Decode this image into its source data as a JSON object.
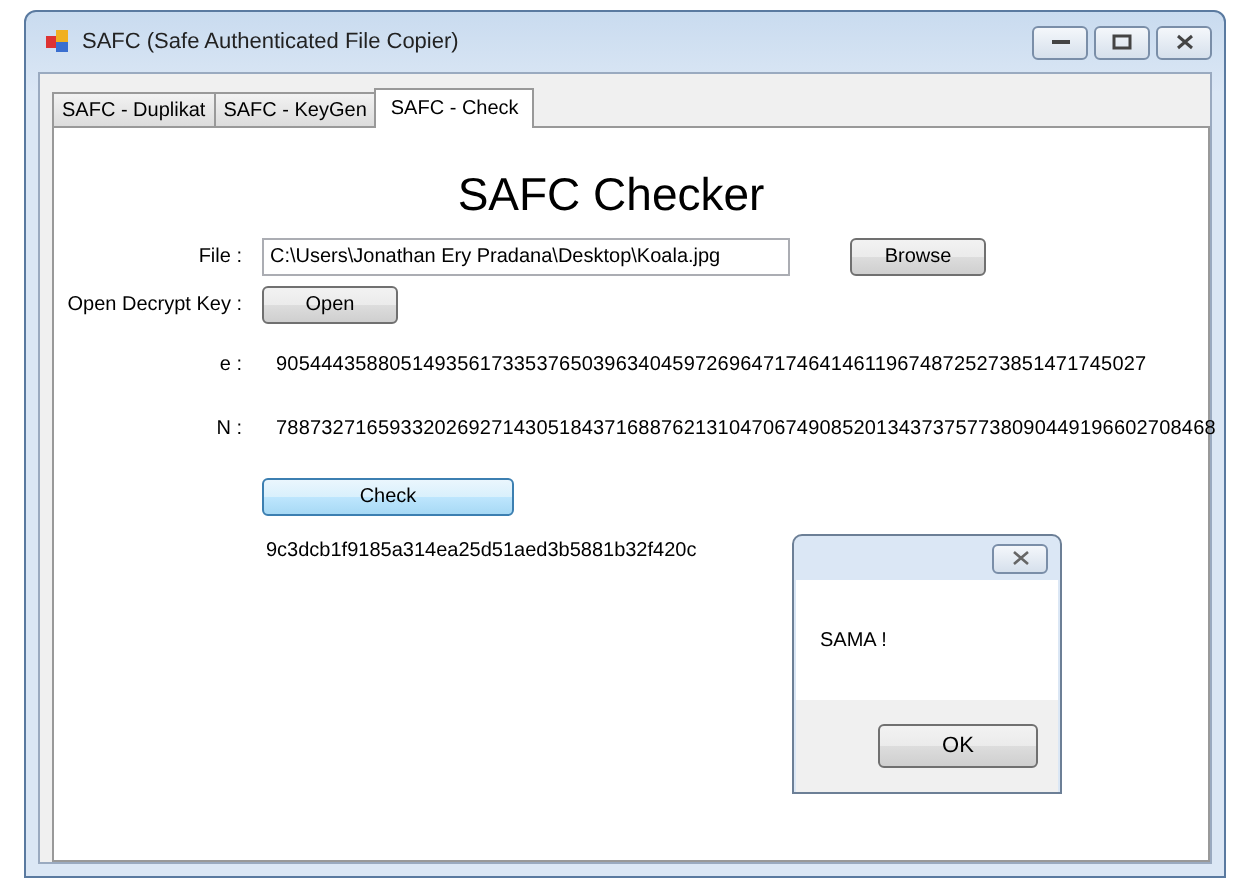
{
  "window": {
    "title": "SAFC (Safe Authenticated File Copier)"
  },
  "tabs": [
    {
      "label": "SAFC - Duplikat",
      "selected": false
    },
    {
      "label": "SAFC - KeyGen",
      "selected": false
    },
    {
      "label": "SAFC - Check",
      "selected": true
    }
  ],
  "heading": "SAFC Checker",
  "file": {
    "label": "File :",
    "value": "C:\\Users\\Jonathan Ery Pradana\\Desktop\\Koala.jpg",
    "button": "Browse"
  },
  "decrypt_key": {
    "label": "Open Decrypt Key :",
    "button": "Open"
  },
  "e": {
    "label": "e :",
    "value": "90544435880514935617335376503963404597269647174641461196748725273851471745027"
  },
  "n": {
    "label": "N :",
    "value": "78873271659332026927143051843716887621310470674908520134373757738090449196602708468"
  },
  "check_button": "Check",
  "hash": "9c3dcb1f9185a314ea25d51aed3b5881b32f420c",
  "message_box": {
    "message": "SAMA !",
    "button": "OK"
  }
}
